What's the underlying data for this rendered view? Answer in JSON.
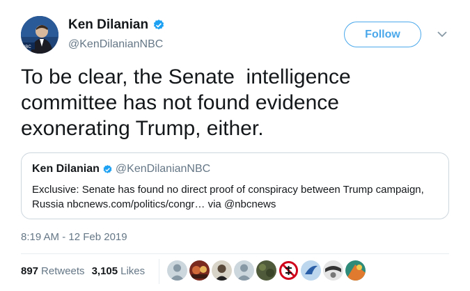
{
  "author": {
    "name": "Ken Dilanian",
    "handle": "@KenDilanianNBC",
    "avatar_label": "NBC"
  },
  "follow_label": "Follow",
  "tweet_text": "To be clear, the Senate  intelligence committee has not found evidence exonerating Trump, either.",
  "quoted": {
    "name": "Ken Dilanian",
    "handle": "@KenDilanianNBC",
    "text": "Exclusive: Senate has found no direct proof of conspiracy between Trump campaign, Russia nbcnews.com/politics/congr… via @nbcnews"
  },
  "timestamp": "8:19 AM - 12 Feb 2019",
  "stats": {
    "retweets_count": "897",
    "retweets_label": "Retweets",
    "likes_count": "3,105",
    "likes_label": "Likes"
  },
  "colors": {
    "accent": "#1da1f2",
    "follow_border": "#4aa8eb",
    "secondary_text": "#657786",
    "border": "#ccd6dd"
  },
  "icons": {
    "verified": "verified-badge-icon",
    "caret": "chevron-down-icon"
  }
}
